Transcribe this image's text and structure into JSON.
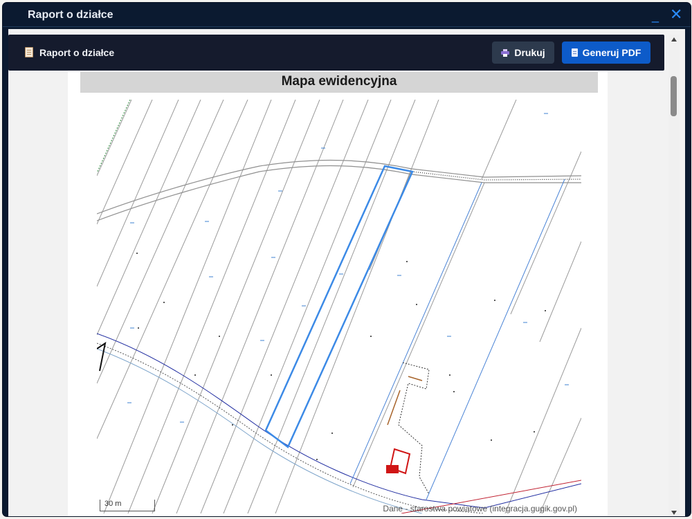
{
  "window": {
    "title": "Raport o działce",
    "minimize_glyph": "_",
    "close_glyph": "✕"
  },
  "header": {
    "icon": "clipboard-icon",
    "title": "Raport o działce",
    "print_label": "Drukuj",
    "print_icon": "printer-icon",
    "pdf_label": "Generuj PDF",
    "pdf_icon": "document-icon"
  },
  "report": {
    "section_title": "Mapa ewidencyjna",
    "scale_label": "30 m",
    "attribution": "Dane - starostwa powiatowe (integracja.gugik.gov.pl)"
  },
  "colors": {
    "window_bg": "#0b1a30",
    "header_bg": "#151b2d",
    "accent": "#2a8cff",
    "pdf_button": "#0d5bc9",
    "selected_parcel": "#3c8ae6",
    "building": "#d01515"
  }
}
